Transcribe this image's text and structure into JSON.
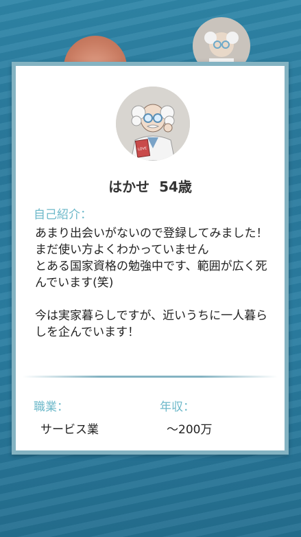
{
  "profile": {
    "name": "はかせ",
    "age": "54歳",
    "avatar_icon": "professor-avatar-icon"
  },
  "intro": {
    "label": "自己紹介：",
    "text": "あまり出会いがないので登録してみました！\nまだ使い方よくわかっていません\nとある国家資格の勉強中です、範囲が広く死んでいます(笑)\n\n今は実家暮らしですが、近いうちに一人暮らしを企んでいます！"
  },
  "job": {
    "label": "職業：",
    "value": "サービス業"
  },
  "income": {
    "label": "年収：",
    "value": "〜200万"
  },
  "colors": {
    "accent": "#6cb8c9",
    "card_border": "#84b3c2",
    "background": "#2b7fa3"
  }
}
